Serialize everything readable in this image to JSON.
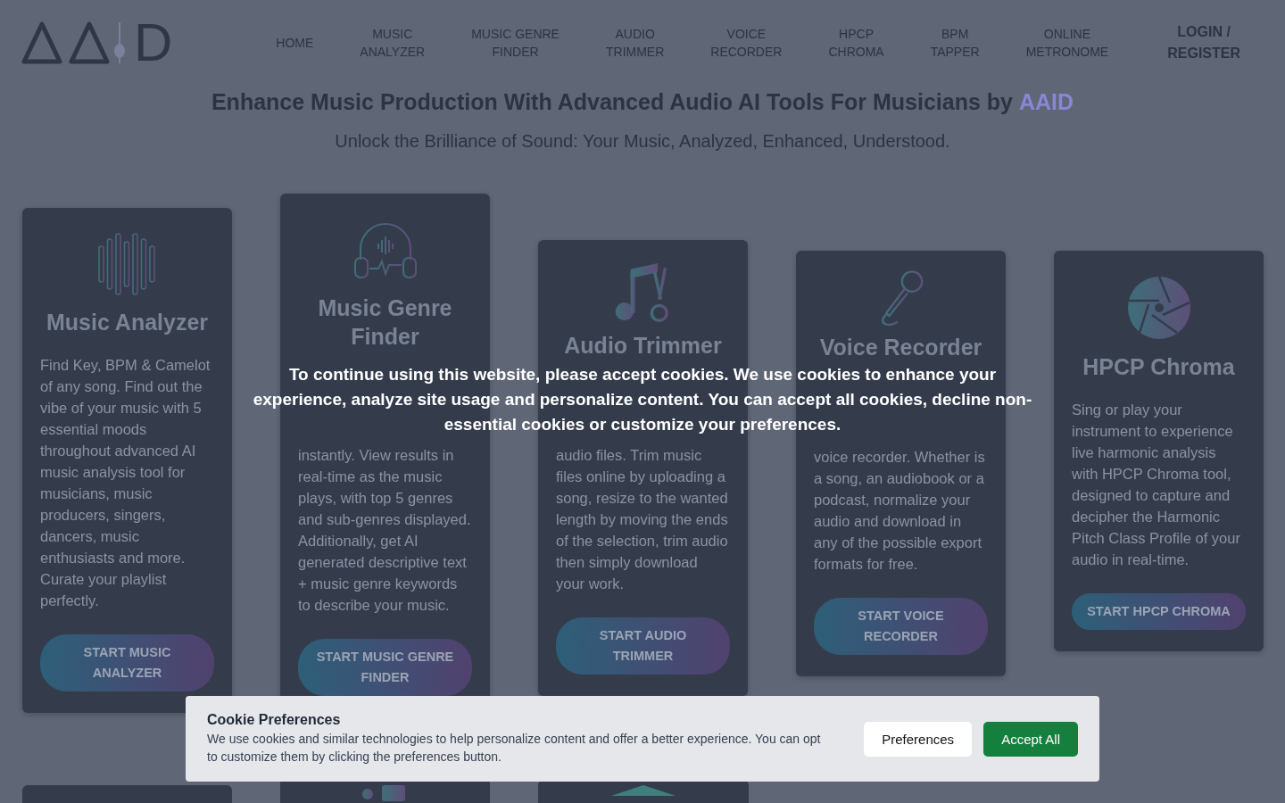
{
  "header": {
    "logo_letter": "D",
    "nav": [
      {
        "label": "HOME",
        "kind": "link"
      },
      {
        "label": "MUSIC\nANALYZER",
        "kind": "link"
      },
      {
        "label": "MUSIC GENRE\nFINDER",
        "kind": "link"
      },
      {
        "label": "AUDIO\nTRIMMER",
        "kind": "link"
      },
      {
        "label": "VOICE\nRECORDER",
        "kind": "link"
      },
      {
        "label": "HPCP\nCHROMA",
        "kind": "link"
      },
      {
        "label": "BPM\nTAPPER",
        "kind": "link"
      },
      {
        "label": "ONLINE\nMETRONOME",
        "kind": "link"
      },
      {
        "label": "LOGIN /\nREGISTER",
        "kind": "account"
      }
    ]
  },
  "hero": {
    "title": "Enhance Music Production With Advanced Audio AI Tools For Musicians by",
    "brand": "AAID",
    "subtitle": "Unlock the Brilliance of Sound: Your Music, Analyzed, Enhanced, Understood."
  },
  "tools": [
    {
      "kind": "waveform",
      "title": "Music Analyzer",
      "description": "Find Key, BPM & Camelot of any song. Find out the vibe of your music with 5 essential moods throughout advanced AI music analysis tool for musicians, music producers, singers, dancers, music enthusiasts and more. Curate your playlist perfectly.",
      "button": "START MUSIC ANALYZER"
    },
    {
      "kind": "headphones",
      "title": "Music Genre Finder",
      "description": "instantly. View results in real-time as the music plays, with top 5 genres and sub-genres displayed. Additionally, get AI generated descriptive text + music genre keywords to describe your music.",
      "button": "START MUSIC GENRE FINDER"
    },
    {
      "kind": "note",
      "title": "Audio Trimmer",
      "description": "audio files. Trim music files online by uploading a song, resize to the wanted length by moving the ends of the selection, trim audio then simply download your work.",
      "button": "START AUDIO TRIMMER"
    },
    {
      "kind": "microphone",
      "title": "Voice Recorder",
      "description": "voice recorder. Whether is a song, an audiobook or a podcast, normalize your audio and download in any of the possible export formats for free.",
      "button": "START VOICE RECORDER"
    },
    {
      "kind": "aperture",
      "title": "HPCP Chroma",
      "description": "Sing or play your instrument to experience live harmonic analysis with HPCP Chroma tool, designed to capture and decipher the Harmonic Pitch Class Profile of your audio in real-time.",
      "button": "START HPCP CHROMA"
    }
  ],
  "more_tools": [
    {
      "kind": "blank"
    },
    {
      "kind": "tapper"
    },
    {
      "kind": "metronome"
    }
  ],
  "overlay_message": "To continue using this website, please accept cookies. We use cookies to enhance your experience, analyze site usage and personalize content. You can accept all cookies, decline non-essential cookies or customize your preferences.",
  "cookie_banner": {
    "title": "Cookie Preferences",
    "text": "We use cookies and similar technologies to help personalize content and offer a better experience. You can opt to customize them by clicking the preferences button.",
    "buttons": [
      {
        "label": "Preferences",
        "kind": "secondary"
      },
      {
        "label": "Accept All",
        "kind": "primary"
      }
    ]
  }
}
